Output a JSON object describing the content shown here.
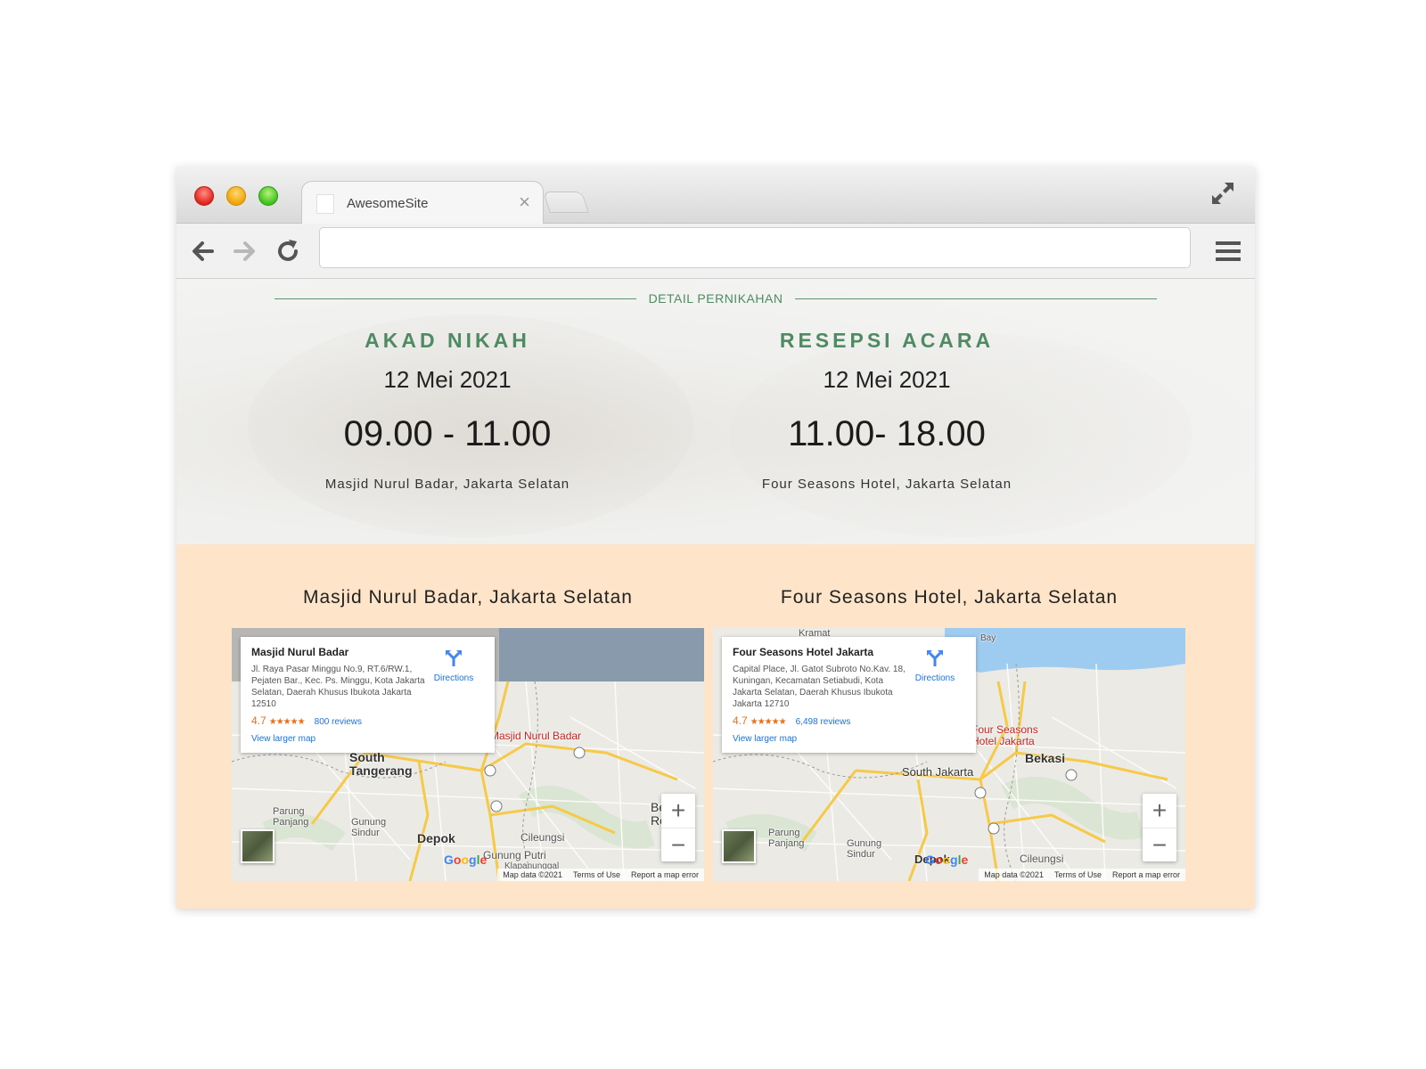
{
  "browser": {
    "tab_title": "AwesomeSite",
    "tab_close": "×",
    "url": ""
  },
  "details": {
    "section_label": "DETAIL PERNIKAHAN",
    "akad": {
      "heading": "AKAD NIKAH",
      "date": "12 Mei 2021",
      "time": "09.00 - 11.00",
      "venue": "Masjid Nurul Badar, Jakarta Selatan"
    },
    "resepsi": {
      "heading": "RESEPSI ACARA",
      "date": "12 Mei 2021",
      "time": "11.00- 18.00",
      "venue": "Four Seasons Hotel, Jakarta Selatan"
    }
  },
  "maps": {
    "left": {
      "title": "Masjid Nurul Badar, Jakarta Selatan",
      "place_name": "Masjid Nurul Badar",
      "address": "Jl. Raya Pasar Minggu No.9, RT.6/RW.1, Pejaten Bar., Kec. Ps. Minggu, Kota Jakarta Selatan, Daerah Khusus Ibukota Jakarta 12510",
      "rating": "4.7",
      "stars": "★★★★★",
      "reviews": "800 reviews",
      "directions": "Directions",
      "larger_map": "View larger map",
      "labels": {
        "pin": "Masjid Nurul Badar",
        "south_tangerang": "South\nTangerang",
        "depok": "Depok",
        "cileungsi": "Cileungsi",
        "parung_panjang": "Parung\nPanjang",
        "gunung_sindur": "Gunung\nSindur",
        "gunung_putri": "Gunung Putri",
        "klapanunggal": "Klapanunggal",
        "be_reg": "Be\nReg"
      }
    },
    "right": {
      "title": "Four Seasons Hotel, Jakarta Selatan",
      "place_name": "Four Seasons Hotel Jakarta",
      "address": "Capital Place, Jl. Gatot Subroto No.Kav. 18, Kuningan, Kecamatan Setiabudi, Kota Jakarta Selatan, Daerah Khusus Ibukota Jakarta 12710",
      "rating": "4.7",
      "stars": "★★★★★",
      "reviews": "6,498 reviews",
      "directions": "Directions",
      "larger_map": "View larger map",
      "labels": {
        "pin": "Four Seasons\nHotel Jakarta",
        "south_jakarta": "South Jakarta",
        "bekasi": "Bekasi",
        "depok": "Depok",
        "cileungsi": "Cileungsi",
        "parung_panjang": "Parung\nPanjang",
        "gunung_sindur": "Gunung\nSindur",
        "kramat": "Kramat",
        "bay": "Bay"
      }
    },
    "zoom_in": "+",
    "zoom_out": "−",
    "google": [
      "G",
      "o",
      "o",
      "g",
      "l",
      "e"
    ],
    "map_data": "Map data ©2021",
    "terms": "Terms of Use",
    "report": "Report a map error"
  },
  "colors": {
    "accent_green": "#4e8a62",
    "map_section_bg": "#fee5c9",
    "link_blue": "#1a73e8",
    "rating_orange": "#e7711b"
  },
  "icons": {
    "back": "arrow-left-icon",
    "forward": "arrow-right-icon",
    "reload": "reload-icon",
    "menu": "hamburger-menu-icon",
    "fullscreen": "expand-icon",
    "directions": "directions-icon"
  }
}
